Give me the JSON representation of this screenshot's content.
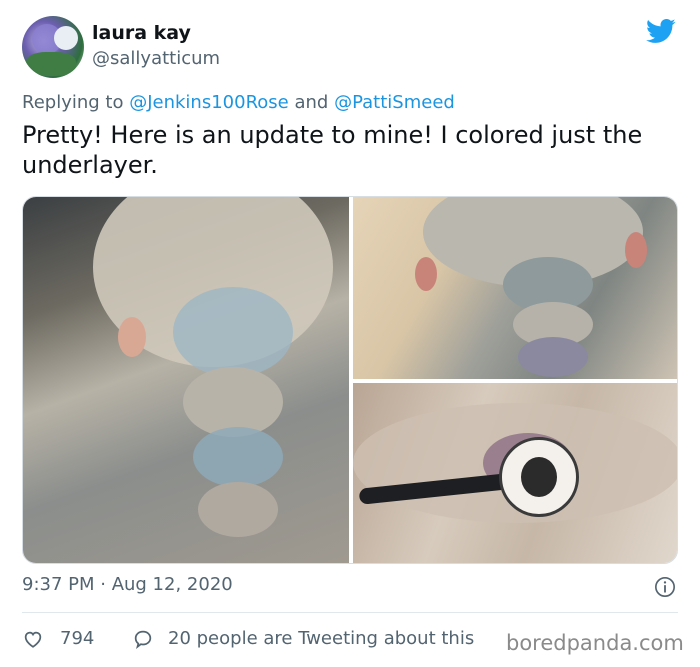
{
  "tweet": {
    "author": {
      "display_name": "laura kay",
      "handle": "@sallyatticum"
    },
    "reply": {
      "prefix": "Replying to",
      "mention_1": "@Jenkins100Rose",
      "joiner": "and",
      "mention_2": "@PattiSmeed"
    },
    "text": "Pretty! Here is an update to mine! I colored just the underlayer.",
    "timestamp": "9:37 PM · Aug 12, 2020",
    "likes": "794",
    "conversation": "20 people are Tweeting about this"
  },
  "watermark": "boredpanda.com",
  "colors": {
    "twitter_blue": "#1da1f2",
    "mention_blue": "#1b95e0",
    "secondary_text": "#536471"
  },
  "icons": [
    "twitter-bird-icon",
    "info-icon",
    "heart-icon",
    "speech-bubble-icon"
  ]
}
